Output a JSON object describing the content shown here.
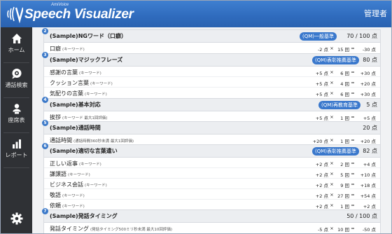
{
  "header": {
    "logo_sub": "AmiVoice",
    "logo_title": "Speech Visualizer",
    "user_name": "管理者"
  },
  "sidebar": {
    "items": [
      {
        "label": "ホーム",
        "icon": "home-icon"
      },
      {
        "label": "通話検索",
        "icon": "chat-search-icon"
      },
      {
        "label": "座席表",
        "icon": "operator-seat-icon"
      },
      {
        "label": "レポート",
        "icon": "bar-chart-icon"
      }
    ],
    "settings_icon": "gear-icon"
  },
  "sections": [
    {
      "num": "2",
      "title": "(Sample)NGワード（口癖）",
      "badge": "(QM)一般基準",
      "score": "70 / 100 点",
      "rows": [
        {
          "label": "口癖",
          "note": "(キーワード)",
          "points": "-2 点",
          "times": "15 回",
          "total": "-30 点"
        }
      ]
    },
    {
      "num": "3",
      "title": "(Sample)マジックフレーズ",
      "badge": "(QM)表彰推薦基準",
      "score": "80 点",
      "rows": [
        {
          "label": "感謝の言葉",
          "note": "(キーワード)",
          "points": "+5 点",
          "times": "6 回",
          "total": "+30 点"
        },
        {
          "label": "クッション言葉",
          "note": "(キーワード)",
          "points": "+5 点",
          "times": "4 回",
          "total": "+20 点"
        },
        {
          "label": "気配りの言葉",
          "note": "(キーワード)",
          "points": "+5 点",
          "times": "6 回",
          "total": "+30 点"
        }
      ]
    },
    {
      "num": "4",
      "title": "(Sample)基本対応",
      "badge": "(QM)再教育基準",
      "score": "5 点",
      "rows": [
        {
          "label": "挨拶",
          "note": "(キーワード 最大1回評価)",
          "points": "+5 点",
          "times": "1 回",
          "total": "+5 点"
        }
      ]
    },
    {
      "num": "5",
      "title": "(Sample)通話時間",
      "badge": "",
      "score": "20 点",
      "rows": [
        {
          "label": "通話時間",
          "note": "(通話時間360秒未満 最大1回評価)",
          "points": "+20 点",
          "times": "1 回",
          "total": "+20 点"
        }
      ]
    },
    {
      "num": "6",
      "title": "(Sample)適切な言葉遣い",
      "badge": "(QM)表彰推薦基準",
      "score": "82 点",
      "rows": [
        {
          "label": "正しい返事",
          "note": "(キーワード)",
          "points": "+2 点",
          "times": "2 回",
          "total": "+4 点"
        },
        {
          "label": "謙譲語",
          "note": "(キーワード)",
          "points": "+2 点",
          "times": "5 回",
          "total": "+10 点"
        },
        {
          "label": "ビジネス会話",
          "note": "(キーワード)",
          "points": "+2 点",
          "times": "9 回",
          "total": "+18 点"
        },
        {
          "label": "敬語",
          "note": "(キーワード)",
          "points": "+2 点",
          "times": "27 回",
          "total": "+54 点"
        },
        {
          "label": "依頼",
          "note": "(キーワード)",
          "points": "+2 点",
          "times": "1 回",
          "total": "+2 点"
        }
      ]
    },
    {
      "num": "7",
      "title": "(Sample)発話タイミング",
      "badge": "",
      "score": "50 / 100 点",
      "rows": [
        {
          "label": "発話タイミング",
          "note": "(発話タイミング500ミリ秒未満 最大10回評価)",
          "points": "-5 点",
          "times": "10 回",
          "total": "-50 点"
        }
      ]
    }
  ],
  "symbols": {
    "times": "×",
    "equals": "="
  },
  "colors": {
    "header": "#2f6bbd",
    "sidebar": "#2f3135",
    "badge": "#3a78cc"
  }
}
